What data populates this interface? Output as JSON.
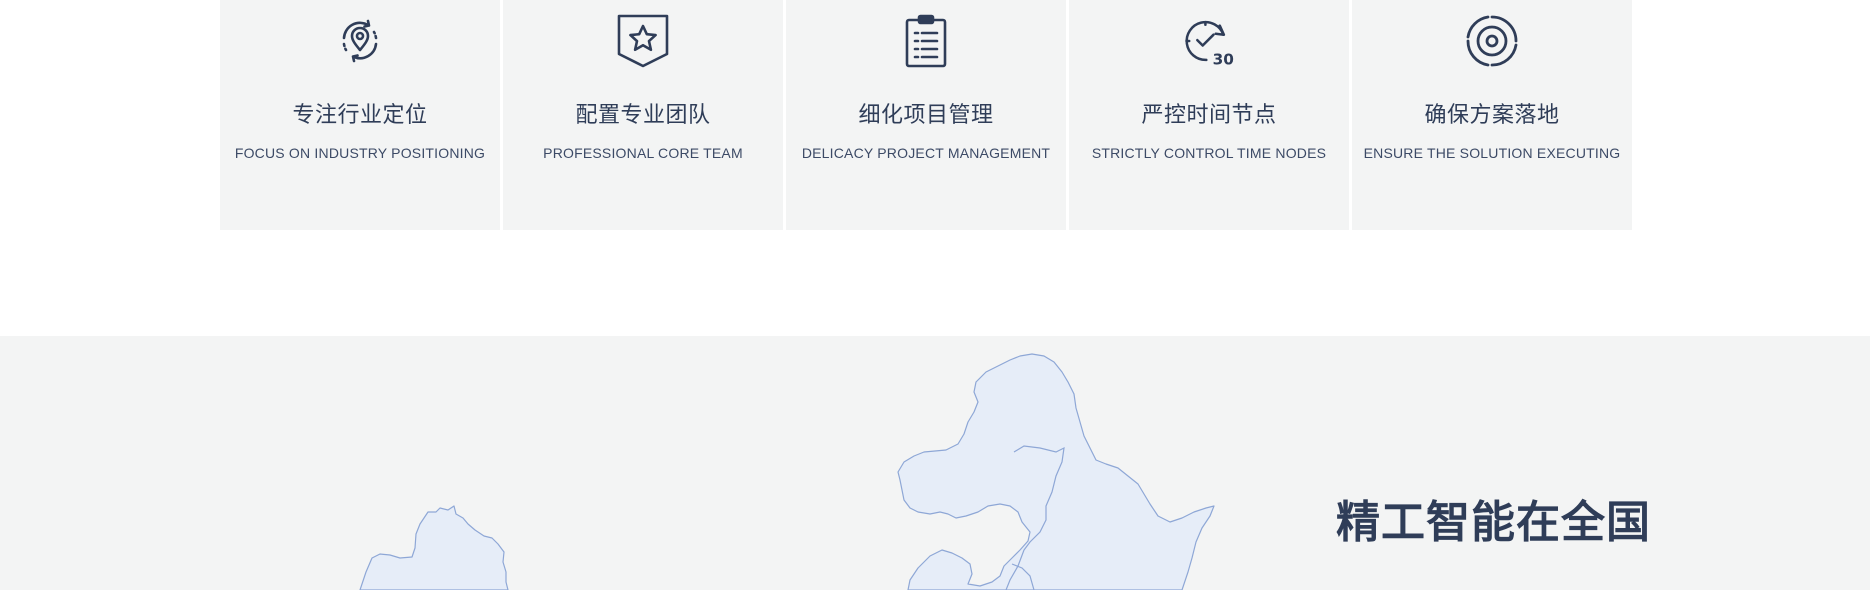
{
  "features": [
    {
      "icon": "location-pin-cycle-icon",
      "title": "专注行业定位",
      "subtitle": "FOCUS ON INDUSTRY POSITIONING"
    },
    {
      "icon": "star-shield-icon",
      "title": "配置专业团队",
      "subtitle": "PROFESSIONAL CORE TEAM"
    },
    {
      "icon": "clipboard-list-icon",
      "title": "细化项目管理",
      "subtitle": "DELICACY PROJECT MANAGEMENT"
    },
    {
      "icon": "clock-check-30-icon",
      "title": "严控时间节点",
      "subtitle": "STRICTLY CONTROL TIME NODES",
      "icon_badge": "30"
    },
    {
      "icon": "target-icon",
      "title": "确保方案落地",
      "subtitle": "ENSURE THE SOLUTION EXECUTING"
    }
  ],
  "map_section": {
    "heading": "精工智能在全国"
  },
  "colors": {
    "card_background": "#f3f4f4",
    "icon_color": "#2f3d58",
    "map_fill": "#e6edf8",
    "map_stroke": "#8ea7d6"
  }
}
